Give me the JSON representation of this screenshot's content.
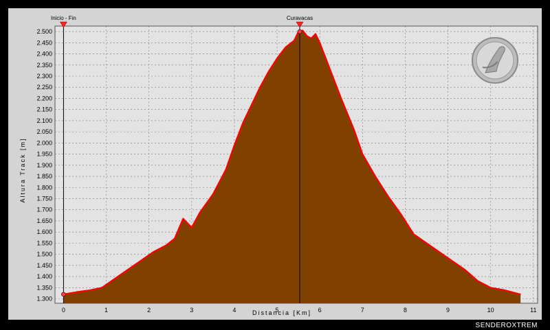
{
  "chart_data": {
    "type": "area",
    "xlabel": "Distancia [Km]",
    "ylabel": "Altura Track [m]",
    "xlim": [
      -0.2,
      11.1
    ],
    "ylim": [
      1280,
      2525
    ],
    "xticks": [
      0,
      1,
      2,
      3,
      4,
      5,
      6,
      7,
      8,
      9,
      10,
      11
    ],
    "yticks": [
      1300,
      1350,
      1400,
      1450,
      1500,
      1550,
      1600,
      1650,
      1700,
      1750,
      1800,
      1850,
      1900,
      1950,
      2000,
      2050,
      2100,
      2150,
      2200,
      2250,
      2300,
      2350,
      2400,
      2450,
      2500
    ],
    "ytick_labels": [
      "1.300",
      "1.350",
      "1.400",
      "1.450",
      "1.500",
      "1.550",
      "1.600",
      "1.650",
      "1.700",
      "1.750",
      "1.800",
      "1.850",
      "1.900",
      "1.950",
      "2.000",
      "2.050",
      "2.100",
      "2.150",
      "2.200",
      "2.250",
      "2.300",
      "2.350",
      "2.400",
      "2.450",
      "2.500"
    ],
    "grid": true,
    "fill_color": "#804000",
    "line_color": "#ff0000",
    "series": [
      {
        "x": [
          0,
          0.3,
          0.6,
          0.9,
          1.2,
          1.5,
          1.8,
          2.1,
          2.4,
          2.6,
          2.8,
          2.9,
          3.0,
          3.2,
          3.5,
          3.8,
          4.0,
          4.2,
          4.4,
          4.6,
          4.8,
          5.0,
          5.2,
          5.4,
          5.5,
          5.6,
          5.7,
          5.8,
          5.9,
          6.0,
          6.2,
          6.5,
          6.8,
          7.0,
          7.3,
          7.6,
          7.9,
          8.2,
          8.5,
          8.8,
          9.1,
          9.4,
          9.7,
          10.0,
          10.3,
          10.5,
          10.7
        ],
        "y": [
          1320,
          1330,
          1338,
          1350,
          1390,
          1430,
          1470,
          1510,
          1540,
          1570,
          1660,
          1640,
          1620,
          1690,
          1770,
          1880,
          1990,
          2090,
          2170,
          2250,
          2320,
          2380,
          2430,
          2460,
          2500,
          2505,
          2480,
          2470,
          2490,
          2450,
          2350,
          2200,
          2060,
          1950,
          1850,
          1760,
          1680,
          1590,
          1550,
          1510,
          1470,
          1430,
          1380,
          1350,
          1340,
          1330,
          1320
        ]
      }
    ],
    "waypoints": [
      {
        "label": "Inicio - Fin",
        "x": 0,
        "y": 1320
      },
      {
        "label": "Curavacas",
        "x": 5.53,
        "y": 2500
      }
    ]
  },
  "credit": "SENDEROXTREM",
  "logo_icon": "climber-emblem-icon"
}
